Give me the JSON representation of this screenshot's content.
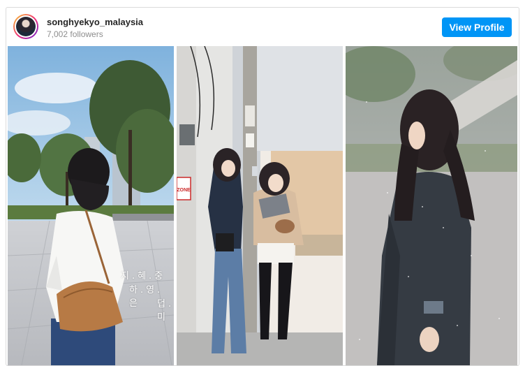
{
  "profile": {
    "username": "songhyekyo_malaysia",
    "followers": "7,002 followers",
    "button_label": "View Profile"
  },
  "photos": [
    {
      "name": "Woman in white shirt with brown bag on plaza",
      "overlay_lines": [
        "지.혜.중",
        "하.영.은",
        "덥.미"
      ]
    },
    {
      "name": "Two women on street with phone and tablet",
      "sign_text": "ZONE"
    },
    {
      "name": "Woman in dark coat in rain"
    }
  ],
  "colors": {
    "button_bg": "#0095f6",
    "button_text": "#ffffff",
    "username": "#262626",
    "followers": "#8e8e8e",
    "border": "#dbdbdb"
  }
}
